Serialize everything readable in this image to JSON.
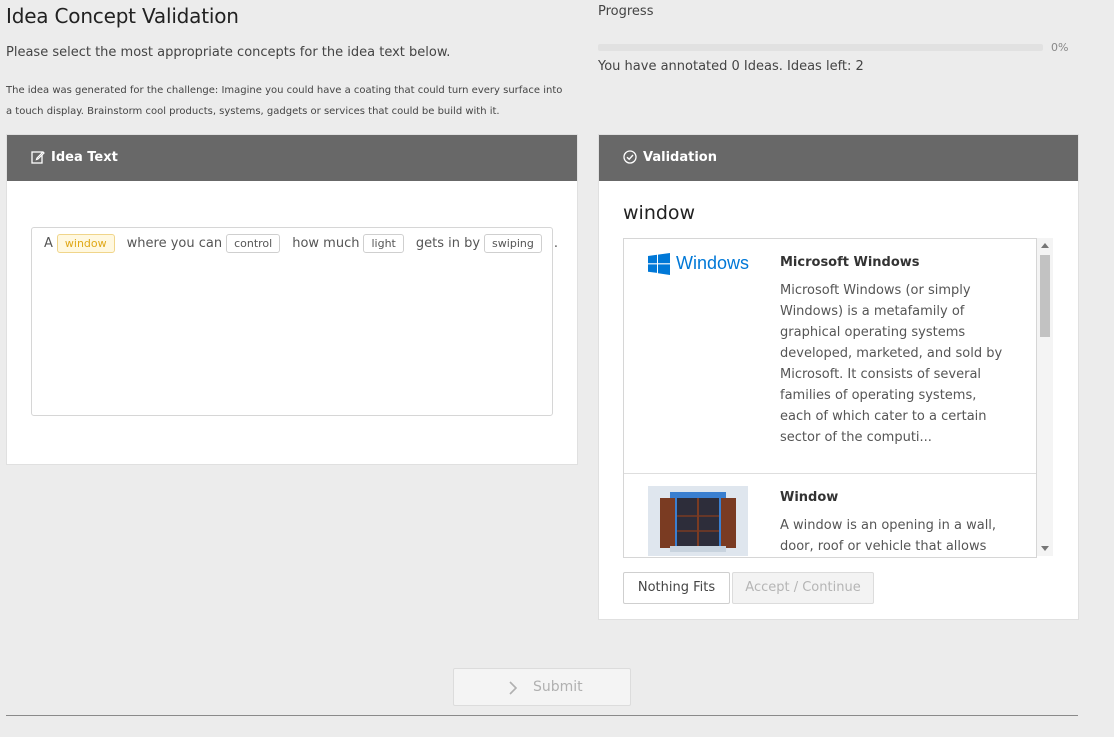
{
  "header": {
    "title": "Idea Concept Validation",
    "subtitle": "Please select the most appropriate concepts for the idea text below.",
    "challenge": "The idea was generated for the challenge: Imagine you could have a coating that could turn every surface into a touch display. Brainstorm cool products, systems, gadgets or services that could be build with it."
  },
  "progress": {
    "label": "Progress",
    "percent_value": 0,
    "percent_text": "0%",
    "annotated_text": "You have annotated 0 Ideas. Ideas left: 2",
    "bar_color": "#5b9bd5"
  },
  "idea_panel": {
    "title": "Idea Text",
    "icon": "edit-icon",
    "segments": [
      {
        "text": "A",
        "token": false
      },
      {
        "text": "window",
        "token": true,
        "selected": true
      },
      {
        "text": "where you can",
        "token": false
      },
      {
        "text": "control",
        "token": true,
        "selected": false
      },
      {
        "text": "how much",
        "token": false
      },
      {
        "text": "light",
        "token": true,
        "selected": false
      },
      {
        "text": "gets in by",
        "token": false
      },
      {
        "text": "swiping",
        "token": true,
        "selected": false
      },
      {
        "text": ".",
        "token": false
      }
    ]
  },
  "validation": {
    "title": "Validation",
    "icon": "check-circle-icon",
    "word": "window",
    "candidates": [
      {
        "name": "Microsoft Windows",
        "logo_text": "Windows",
        "description": "Microsoft Windows (or simply Windows) is a metafamily of graphical operating systems developed, marketed, and sold by Microsoft. It consists of several families of operating systems, each of which cater to a certain sector of the computi..."
      },
      {
        "name": "Window",
        "description": "A window is an opening in a wall, door, roof or vehicle that allows the"
      }
    ],
    "buttons": {
      "nothing_fits": "Nothing Fits",
      "accept_continue": "Accept / Continue"
    }
  },
  "footer": {
    "submit_label": "Submit"
  },
  "colors": {
    "panel_header": "#686868",
    "selected_token_border": "#f0d58a",
    "selected_token_text": "#e0a818",
    "windows_blue": "#0078d7"
  }
}
